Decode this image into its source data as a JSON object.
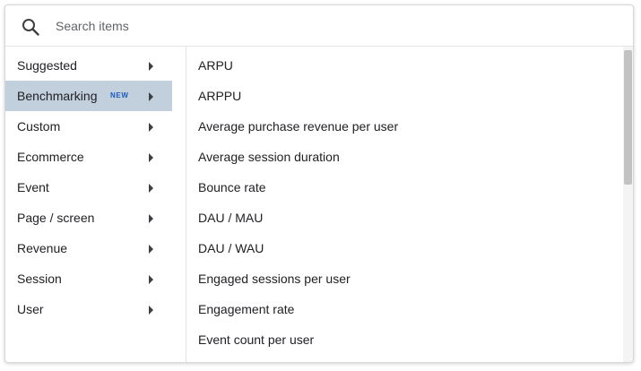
{
  "search": {
    "placeholder": "Search items",
    "icon": "search-icon"
  },
  "categories": [
    {
      "label": "Suggested",
      "badge": "",
      "selected": false
    },
    {
      "label": "Benchmarking",
      "badge": "NEW",
      "selected": true
    },
    {
      "label": "Custom",
      "badge": "",
      "selected": false
    },
    {
      "label": "Ecommerce",
      "badge": "",
      "selected": false
    },
    {
      "label": "Event",
      "badge": "",
      "selected": false
    },
    {
      "label": "Page / screen",
      "badge": "",
      "selected": false
    },
    {
      "label": "Revenue",
      "badge": "",
      "selected": false
    },
    {
      "label": "Session",
      "badge": "",
      "selected": false
    },
    {
      "label": "User",
      "badge": "",
      "selected": false
    }
  ],
  "metrics": [
    "ARPU",
    "ARPPU",
    "Average purchase revenue per user",
    "Average session duration",
    "Bounce rate",
    "DAU / MAU",
    "DAU / WAU",
    "Engaged sessions per user",
    "Engagement rate",
    "Event count per user"
  ],
  "colors": {
    "selected_background": "#c2cfdd",
    "badge_text": "#1a5bbf",
    "text": "#202124",
    "scrollbar_thumb": "#c2c2c2"
  }
}
